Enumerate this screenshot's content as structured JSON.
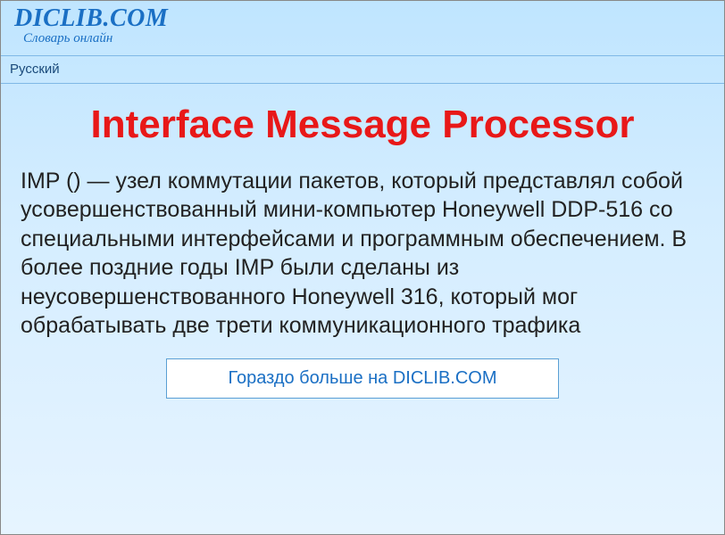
{
  "header": {
    "site_title": "DICLIB.COM",
    "site_subtitle": "Словарь онлайн"
  },
  "navbar": {
    "language": "Русский"
  },
  "article": {
    "title": "Interface Message Processor",
    "body": "IMP () — узел коммутации пакетов, который представлял собой усовершенствованный мини-компьютер Honeywell DDP-516 со специальными интерфейсами и программным обеспечением. В более поздние годы IMP были сделаны из неусовершенствованного Honeywell 316, который мог обрабатывать две трети коммуникационного трафика"
  },
  "cta": {
    "label": "Гораздо больше на DICLIB.COM"
  }
}
